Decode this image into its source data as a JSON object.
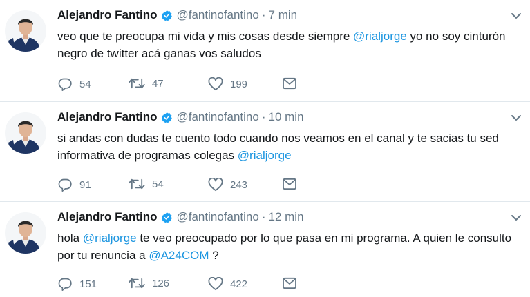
{
  "tweets": [
    {
      "author_name": "Alejandro Fantino",
      "handle": "@fantinofantino",
      "separator": "·",
      "time": "7 min",
      "text_parts": [
        {
          "text": "veo que te preocupa mi vida y mis cosas desde siempre ",
          "mention": false
        },
        {
          "text": "@rialjorge",
          "mention": true
        },
        {
          "text": " yo no soy cinturón negro de twitter acá ganas vos  saludos",
          "mention": false
        }
      ],
      "replies": "54",
      "retweets": "47",
      "likes": "199"
    },
    {
      "author_name": "Alejandro Fantino",
      "handle": "@fantinofantino",
      "separator": "·",
      "time": "10 min",
      "text_parts": [
        {
          "text": "si andas con dudas te cuento todo cuando nos veamos en el canal y te sacias tu sed informativa de programas colegas ",
          "mention": false
        },
        {
          "text": "@rialjorge",
          "mention": true
        }
      ],
      "replies": "91",
      "retweets": "54",
      "likes": "243"
    },
    {
      "author_name": "Alejandro Fantino",
      "handle": "@fantinofantino",
      "separator": "·",
      "time": "12 min",
      "text_parts": [
        {
          "text": "hola ",
          "mention": false
        },
        {
          "text": "@rialjorge",
          "mention": true
        },
        {
          "text": " te veo preocupado por lo que pasa en mi programa.  A quien le consulto por tu renuncia a ",
          "mention": false
        },
        {
          "text": "@A24COM",
          "mention": true
        },
        {
          "text": " ?",
          "mention": false
        }
      ],
      "replies": "151",
      "retweets": "126",
      "likes": "422"
    }
  ],
  "colors": {
    "mention": "#1b95e0",
    "muted": "#657786",
    "verified": "#1da1f2",
    "text": "#14171a",
    "divider": "#e1e8ed"
  },
  "icons": {
    "reply": "reply-icon",
    "retweet": "retweet-icon",
    "like": "heart-icon",
    "dm": "envelope-icon",
    "menu": "chevron-down-icon",
    "verified": "verified-badge-icon"
  }
}
